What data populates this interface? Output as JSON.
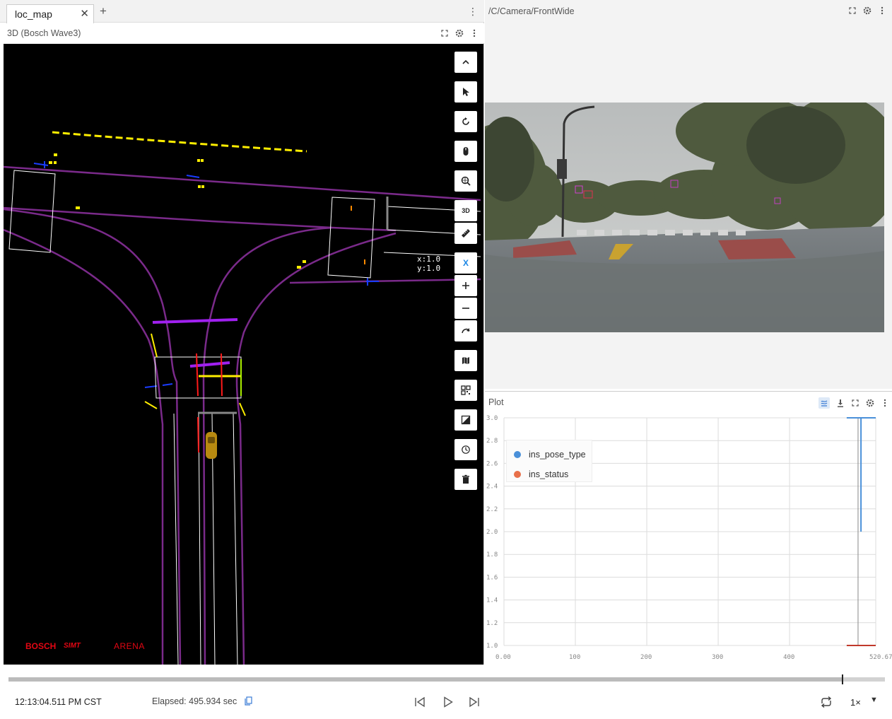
{
  "tabs": {
    "active_tab": "loc_map",
    "close_glyph": "✕",
    "add_glyph": "+",
    "menu_glyph": "⋮"
  },
  "panel_3d": {
    "title": "3D (Bosch Wave3)",
    "coord_x": "x:1.0",
    "coord_y": "y:1.0",
    "logo_bosch": "BOSCH",
    "logo_sim": "SIMT",
    "logo_arena": "ARENA",
    "toolbar_icons": [
      "chevron-up-icon",
      "cursor-icon",
      "reset-view-icon",
      "mouse-icon",
      "search-globe-icon",
      "3d-toggle-icon",
      "ruler-icon",
      "axis-icon",
      "zoom-in-icon",
      "zoom-out-icon",
      "rotate-icon",
      "map-icon",
      "qr-grid-icon",
      "layer-toggle-icon",
      "history-icon",
      "trash-icon"
    ],
    "toggle_3d_label": "3D",
    "axis_label": "X"
  },
  "camera": {
    "title": "/C/Camera/FrontWide"
  },
  "plot": {
    "title": "Plot",
    "legend": [
      {
        "name": "ins_pose_type",
        "color": "#4a90d9"
      },
      {
        "name": "ins_status",
        "color": "#e8704a"
      }
    ]
  },
  "chart_data": {
    "type": "line",
    "title": "",
    "xlabel": "",
    "ylabel": "",
    "xlim": [
      0,
      520.67
    ],
    "ylim": [
      1.0,
      3.0
    ],
    "x_ticks": [
      "0.00",
      "100",
      "200",
      "300",
      "400",
      "520.67"
    ],
    "y_ticks": [
      "1.0",
      "1.2",
      "1.4",
      "1.6",
      "1.8",
      "2.0",
      "2.2",
      "2.4",
      "2.6",
      "2.8",
      "3.0"
    ],
    "grid": true,
    "legend_position": "top-left",
    "cursor_x": 495.9,
    "series": [
      {
        "name": "ins_pose_type",
        "color": "#4a90d9",
        "points": [
          [
            480,
            3.0
          ],
          [
            496,
            3.0
          ],
          [
            500,
            3.0
          ],
          [
            500,
            2.0
          ],
          [
            520.67,
            3.0
          ]
        ]
      },
      {
        "name": "ins_status",
        "color": "#c0392b",
        "points": [
          [
            480,
            1.0
          ],
          [
            520.67,
            1.0
          ]
        ]
      }
    ]
  },
  "playback": {
    "clock": "12:13:04.511 PM CST",
    "elapsed": "Elapsed: 495.934 sec",
    "progress": 0.952,
    "speed": "1×",
    "speed_arrow": "▼"
  }
}
